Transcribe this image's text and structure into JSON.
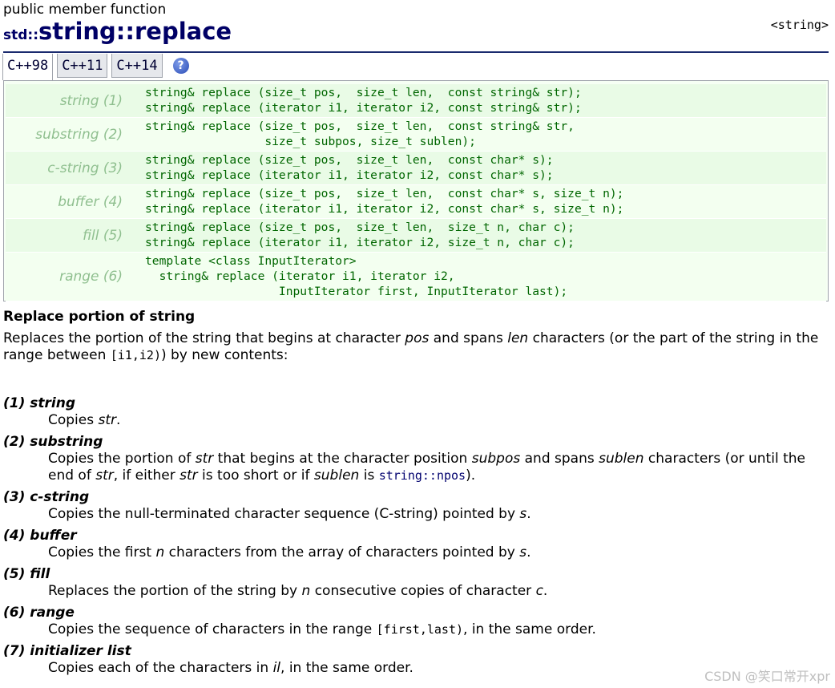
{
  "header": {
    "kind": "public member function",
    "namespace": "std::",
    "name": "string::replace",
    "header_tag": "<string>"
  },
  "tabs": [
    {
      "label": "C++98"
    },
    {
      "label": "C++11"
    },
    {
      "label": "C++14"
    }
  ],
  "help_icon": "help-icon",
  "prototypes": [
    {
      "label": "string (1)",
      "lines": [
        "string& replace (size_t pos,  size_t len,  const string& str);",
        "string& replace (iterator i1, iterator i2, const string& str);"
      ]
    },
    {
      "label": "substring (2)",
      "lines": [
        "string& replace (size_t pos,  size_t len,  const string& str,",
        "                 size_t subpos, size_t sublen);"
      ]
    },
    {
      "label": "c-string (3)",
      "lines": [
        "string& replace (size_t pos,  size_t len,  const char* s);",
        "string& replace (iterator i1, iterator i2, const char* s);"
      ]
    },
    {
      "label": "buffer (4)",
      "lines": [
        "string& replace (size_t pos,  size_t len,  const char* s, size_t n);",
        "string& replace (iterator i1, iterator i2, const char* s, size_t n);"
      ]
    },
    {
      "label": "fill (5)",
      "lines": [
        "string& replace (size_t pos,  size_t len,  size_t n, char c);",
        "string& replace (iterator i1, iterator i2, size_t n, char c);"
      ]
    },
    {
      "label": "range (6)",
      "lines": [
        "template <class InputIterator>",
        "  string& replace (iterator i1, iterator i2,",
        "                   InputIterator first, InputIterator last);"
      ]
    }
  ],
  "section_title": "Replace portion of string",
  "intro": {
    "t1": "Replaces the portion of the string that begins at character ",
    "e1": "pos",
    "t2": " and spans ",
    "e2": "len",
    "t3": " characters (or the part of the string in the range between ",
    "m1": "[i1,i2)",
    "t4": ") by new contents:"
  },
  "params": [
    {
      "term": "(1) string",
      "desc": {
        "a": "Copies ",
        "b": "str",
        "c": "."
      }
    },
    {
      "term": "(2) substring",
      "desc": {
        "a": "Copies the portion of ",
        "b": "str",
        "c": " that begins at the character position ",
        "d": "subpos",
        "e": " and spans ",
        "f": "sublen",
        "g": " characters (or until the end of ",
        "h": "str",
        "i": ", if either ",
        "j": "str",
        "k": " is too short or if ",
        "l": "sublen",
        "m": " is ",
        "n": "string::npos",
        "o": ")."
      }
    },
    {
      "term": "(3) c-string",
      "desc": {
        "a": "Copies the null-terminated character sequence (C-string) pointed by ",
        "b": "s",
        "c": "."
      }
    },
    {
      "term": "(4) buffer",
      "desc": {
        "a": "Copies the first ",
        "b": "n",
        "c": " characters from the array of characters pointed by ",
        "d": "s",
        "e": "."
      }
    },
    {
      "term": "(5) fill",
      "desc": {
        "a": "Replaces the portion of the string by ",
        "b": "n",
        "c": " consecutive copies of character ",
        "d": "c",
        "e": "."
      }
    },
    {
      "term": "(6) range",
      "desc": {
        "a": "Copies the sequence of characters in the range ",
        "b": "[first,last)",
        "c": ", in the same order."
      }
    },
    {
      "term": "(7) initializer list",
      "desc": {
        "a": "Copies each of the characters in ",
        "b": "il",
        "c": ", in the same order."
      }
    }
  ],
  "watermark": "CSDN @笑口常开xpr"
}
